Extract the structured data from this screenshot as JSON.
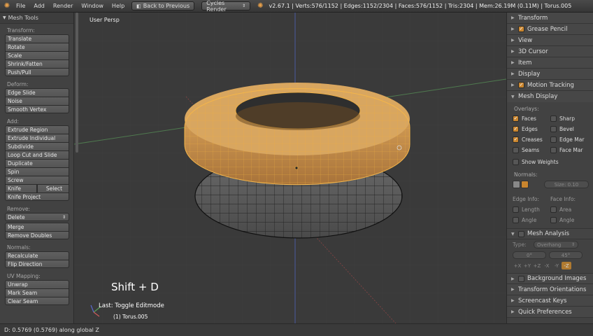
{
  "header": {
    "menus": [
      "File",
      "Add",
      "Render",
      "Window",
      "Help"
    ],
    "back_button": "Back to Previous",
    "render_engine": "Cycles Render",
    "stats": "v2.67.1 | Verts:576/1152 | Edges:1152/2304 | Faces:576/1152 | Tris:2304 | Mem:26.19M (0.11M) | Torus.005"
  },
  "toolshelf": {
    "title": "Mesh Tools",
    "transform_label": "Transform:",
    "transform": [
      "Translate",
      "Rotate",
      "Scale",
      "Shrink/Fatten",
      "Push/Pull"
    ],
    "deform_label": "Deform:",
    "deform": [
      "Edge Slide",
      "Noise",
      "Smooth Vertex"
    ],
    "add_label": "Add:",
    "add": [
      "Extrude Region",
      "Extrude Individual",
      "Subdivide",
      "Loop Cut and Slide",
      "Duplicate",
      "Spin",
      "Screw"
    ],
    "knife": "Knife",
    "select": "Select",
    "knife_project": "Knife Project",
    "remove_label": "Remove:",
    "delete": "Delete",
    "remove": [
      "Merge",
      "Remove Doubles"
    ],
    "normals_label": "Normals:",
    "normals": [
      "Recalculate",
      "Flip Direction"
    ],
    "uv_label": "UV Mapping:",
    "uv": [
      "Unwrap",
      "Mark Seam",
      "Clear Seam"
    ]
  },
  "viewport": {
    "view_name": "User Persp",
    "shortcut_overlay": "Shift + D",
    "last_operator": "Last: Toggle Editmode",
    "object_label": "(1) Torus.005"
  },
  "properties": {
    "transform": "Transform",
    "grease_pencil": "Grease Pencil",
    "view": "View",
    "cursor": "3D Cursor",
    "item": "Item",
    "display": "Display",
    "motion_tracking": "Motion Tracking",
    "mesh_display": "Mesh Display",
    "overlays_label": "Overlays:",
    "faces": "Faces",
    "sharp": "Sharp",
    "edges": "Edges",
    "bevel": "Bevel",
    "creases": "Creases",
    "edge_marks": "Edge Mar",
    "seams": "Seams",
    "face_marks": "Face Mar",
    "show_weights": "Show Weights",
    "normals_label": "Normals:",
    "normal_size": "Size: 0.10",
    "edge_info_label": "Edge Info:",
    "face_info_label": "Face Info:",
    "length": "Length",
    "area": "Area",
    "angle_edge": "Angle",
    "angle_face": "Angle",
    "mesh_analysis": "Mesh Analysis",
    "type_label": "Type:",
    "type_value": "Overhang",
    "min_angle": "0°",
    "max_angle": "45°",
    "axes": [
      "+X",
      "+Y",
      "+Z",
      "-X",
      "-Y",
      "-Z"
    ],
    "background_images": "Background Images",
    "transform_orientations": "Transform Orientations",
    "screencast_keys": "Screencast Keys",
    "quick_preferences": "Quick Preferences"
  },
  "status": {
    "text": "D: 0.5769 (0.5769) along global Z"
  },
  "colors": {
    "selected_mesh": "#c9934f",
    "unselected_mesh": "#585858",
    "accent": "#e8a04a"
  }
}
